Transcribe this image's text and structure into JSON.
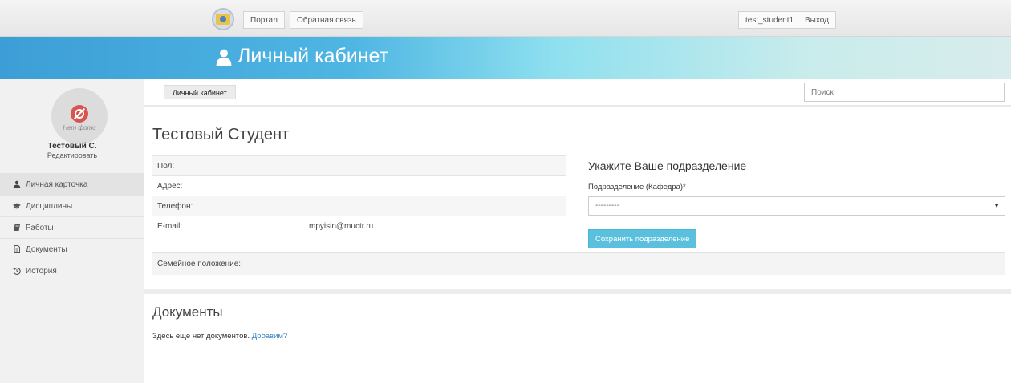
{
  "topnav": {
    "portal": "Портал",
    "feedback": "Обратная связь",
    "username": "test_student1",
    "logout": "Выход"
  },
  "banner": {
    "title": "Личный кабинет"
  },
  "sidebar": {
    "no_photo": "Нет фото",
    "name": "Тестовый С.",
    "edit": "Редактировать",
    "items": [
      {
        "label": "Личная карточка",
        "icon": "user-icon"
      },
      {
        "label": "Дисциплины",
        "icon": "graduation-cap-icon"
      },
      {
        "label": "Работы",
        "icon": "book-icon"
      },
      {
        "label": "Документы",
        "icon": "document-icon"
      },
      {
        "label": "История",
        "icon": "history-icon"
      }
    ]
  },
  "breadcrumb": {
    "label": "Личный кабинет"
  },
  "search": {
    "placeholder": "Поиск"
  },
  "profile": {
    "full_name": "Тестовый Студент",
    "gender_label": "Пол:",
    "address_label": "Адрес:",
    "phone_label": "Телефон:",
    "email_label": "E-mail:",
    "email_value": "mpyisin@muctr.ru",
    "family_label": "Семейное положение:"
  },
  "department": {
    "title": "Укажите Ваше подразделение",
    "label": "Подразделение (Кафедра)*",
    "selected": "---------",
    "save": "Сохранить подразделение"
  },
  "documents": {
    "title": "Документы",
    "empty_text": "Здесь еще нет документов.",
    "add_link": "Добавим?"
  },
  "colors": {
    "accent": "#5bc0de",
    "link": "#3a7fc2",
    "no_photo_icon": "#d9534f"
  }
}
